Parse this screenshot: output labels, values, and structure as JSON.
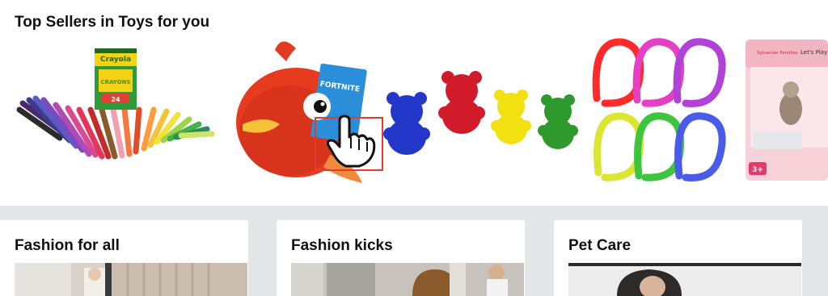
{
  "top_section": {
    "title": "Top Sellers in Toys for you",
    "products": [
      {
        "name": "crayola-crayons",
        "box_brand": "Crayola",
        "box_label": "CRAYONS",
        "box_count": "24"
      },
      {
        "name": "fortnite-plush-fish",
        "card_label": "FORTNITE"
      },
      {
        "name": "counting-bears"
      },
      {
        "name": "stretchy-string-toys"
      },
      {
        "name": "sylvanian-families-set",
        "box_brand": "Sylvanian Families",
        "box_text": "Let's Play",
        "age_badge": "3+"
      }
    ]
  },
  "cards": [
    {
      "title": "Fashion for all"
    },
    {
      "title": "Fashion kicks"
    },
    {
      "title": "Pet Care"
    }
  ],
  "colors": {
    "accent_box": "#e43b2c",
    "page_bg": "#e3e6e6"
  }
}
